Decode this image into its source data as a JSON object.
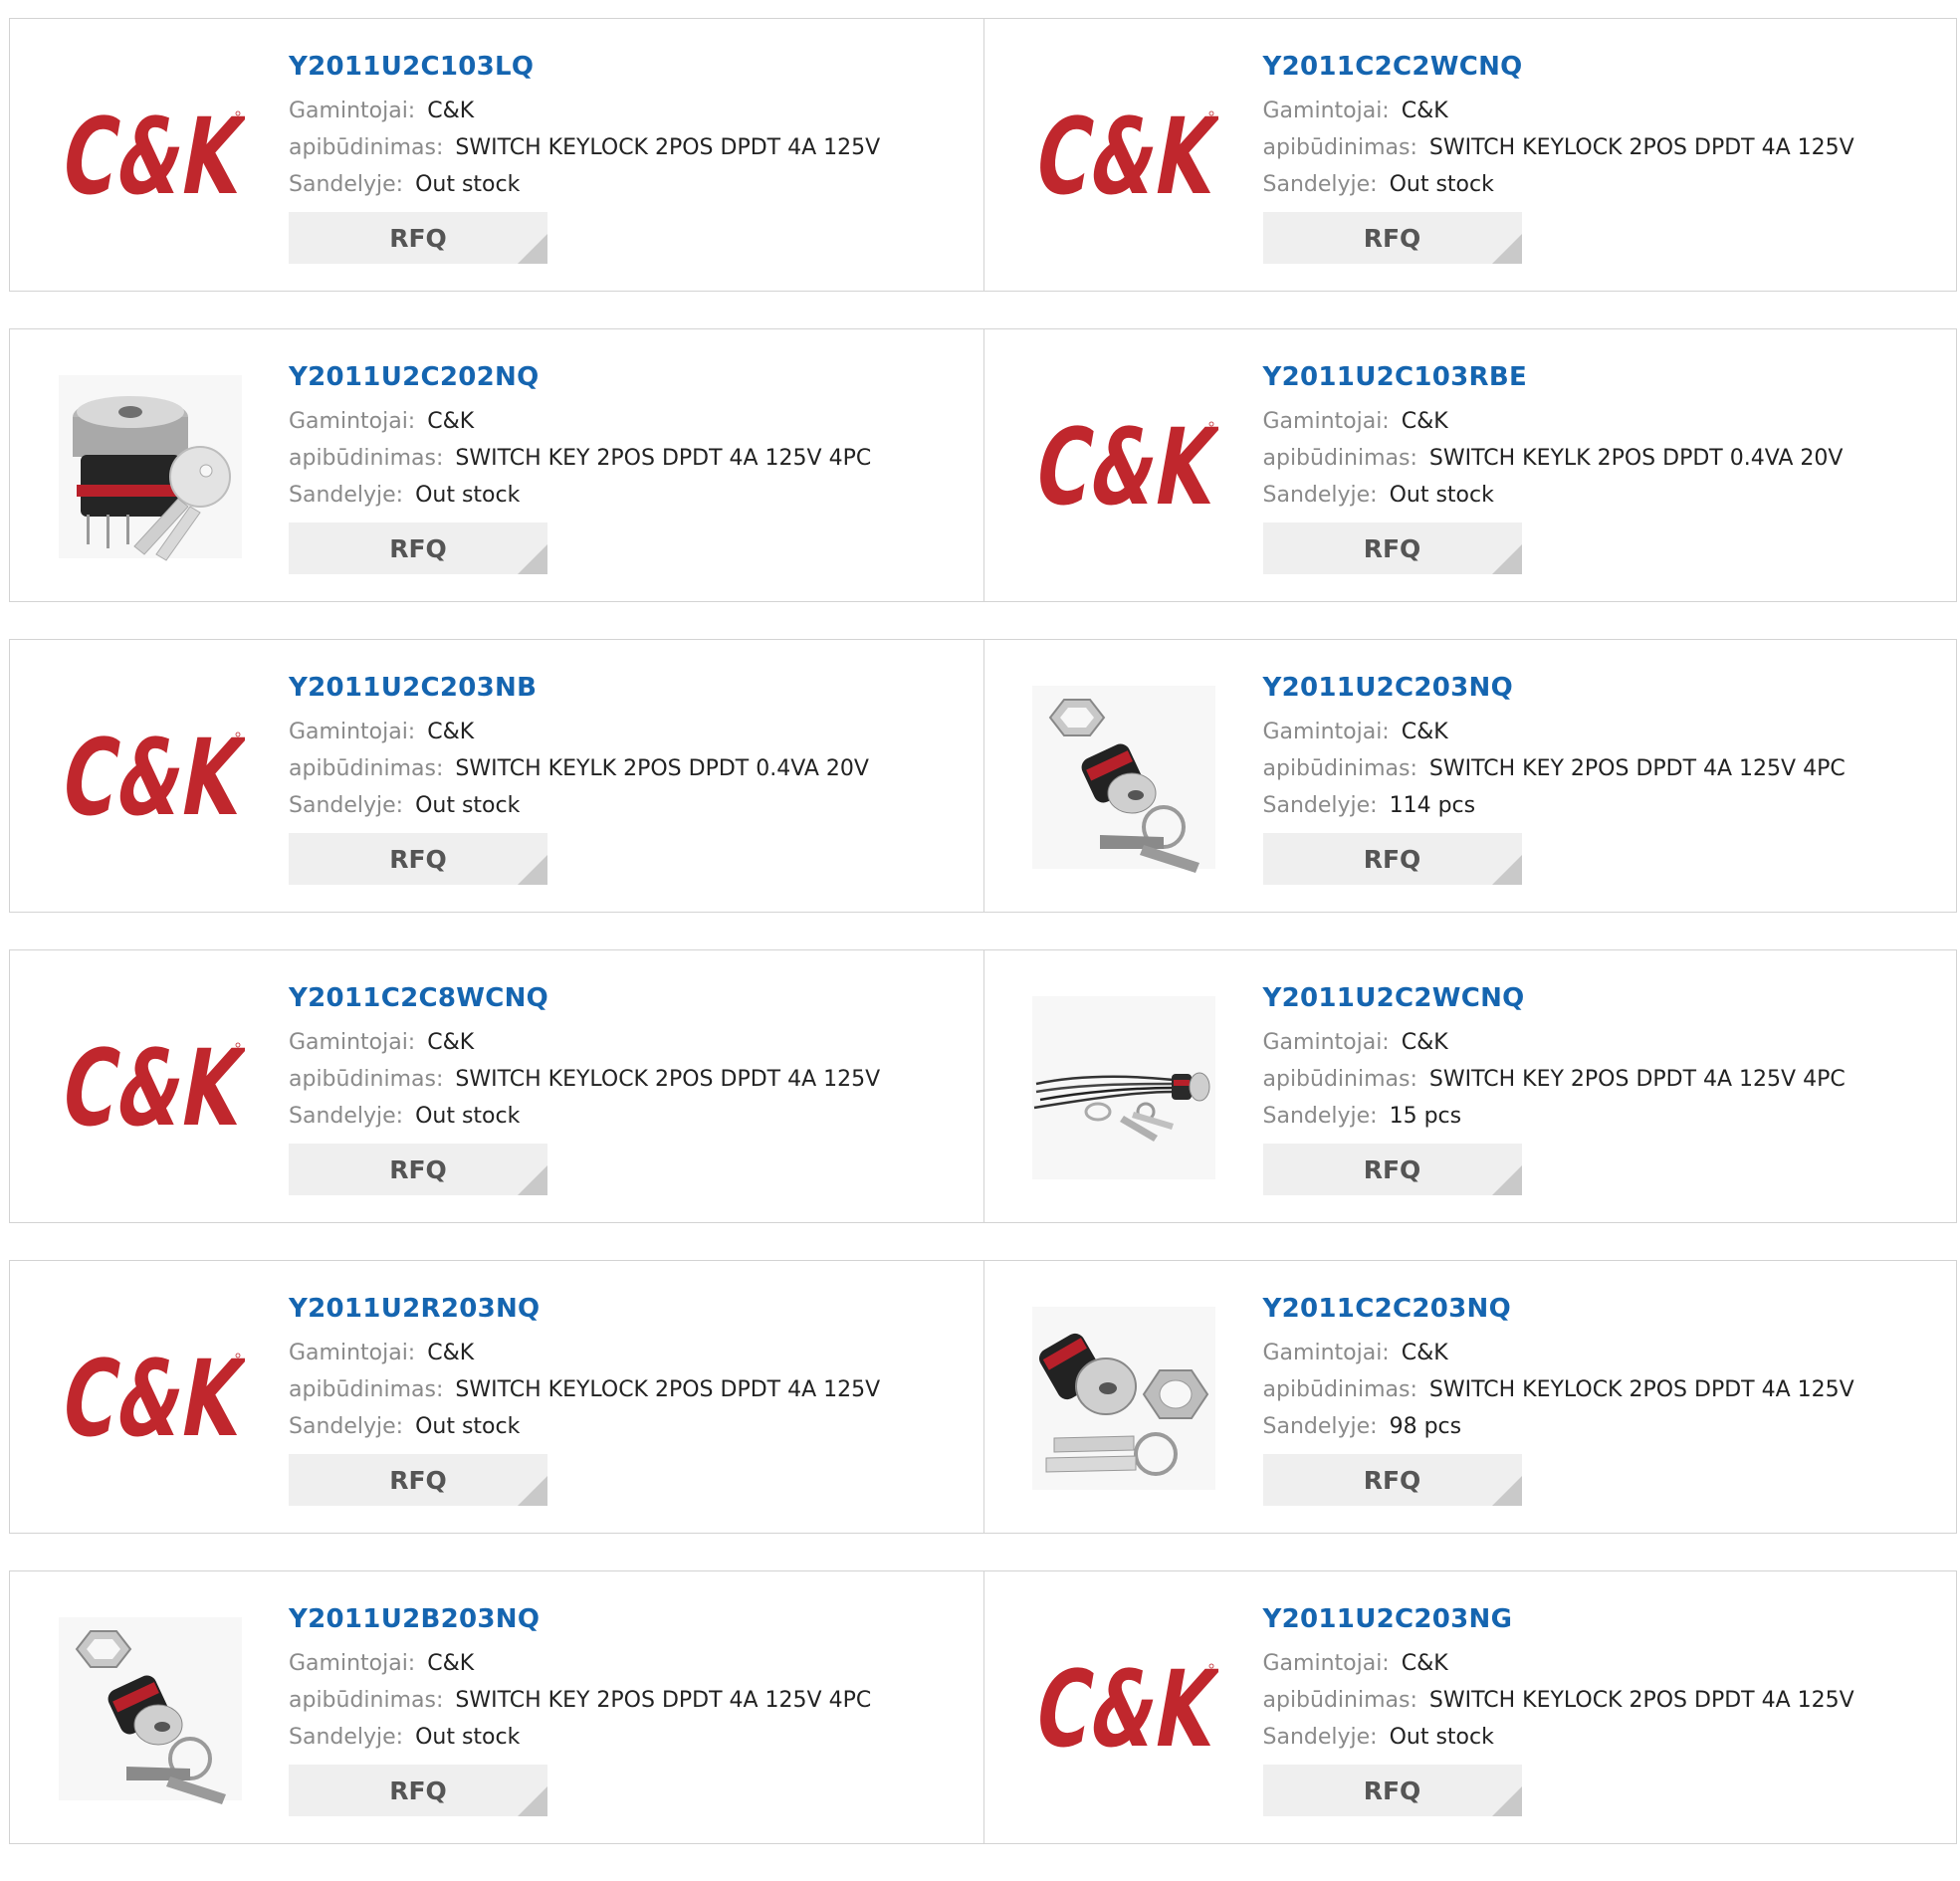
{
  "labels": {
    "manufacturer": "Gamintojai:",
    "description": "apibūdinimas:",
    "stock": "Sandelyje:",
    "rfq": "RFQ"
  },
  "colors": {
    "part_link": "#1565b0",
    "brand_red": "#c0272d",
    "rfq_bg": "#efefef"
  },
  "products": [
    {
      "part": "Y2011U2C103LQ",
      "manufacturer": "C&K",
      "description": "SWITCH KEYLOCK 2POS DPDT 4A 125V",
      "stock": "Out stock",
      "image": "ck-logo"
    },
    {
      "part": "Y2011C2C2WCNQ",
      "manufacturer": "C&K",
      "description": "SWITCH KEYLOCK 2POS DPDT 4A 125V",
      "stock": "Out stock",
      "image": "ck-logo"
    },
    {
      "part": "Y2011U2C202NQ",
      "manufacturer": "C&K",
      "description": "SWITCH KEY 2POS DPDT 4A 125V 4PC",
      "stock": "Out stock",
      "image": "keylock-switch-photo"
    },
    {
      "part": "Y2011U2C103RBE",
      "manufacturer": "C&K",
      "description": "SWITCH KEYLK 2POS DPDT 0.4VA 20V",
      "stock": "Out stock",
      "image": "ck-logo"
    },
    {
      "part": "Y2011U2C203NB",
      "manufacturer": "C&K",
      "description": "SWITCH KEYLK 2POS DPDT 0.4VA 20V",
      "stock": "Out stock",
      "image": "ck-logo"
    },
    {
      "part": "Y2011U2C203NQ",
      "manufacturer": "C&K",
      "description": "SWITCH KEY 2POS DPDT 4A 125V 4PC",
      "stock": "114 pcs",
      "image": "keylock-nut-keys-photo"
    },
    {
      "part": "Y2011C2C8WCNQ",
      "manufacturer": "C&K",
      "description": "SWITCH KEYLOCK 2POS DPDT 4A 125V",
      "stock": "Out stock",
      "image": "ck-logo"
    },
    {
      "part": "Y2011U2C2WCNQ",
      "manufacturer": "C&K",
      "description": "SWITCH KEY 2POS DPDT 4A 125V 4PC",
      "stock": "15 pcs",
      "image": "keylock-wires-photo"
    },
    {
      "part": "Y2011U2R203NQ",
      "manufacturer": "C&K",
      "description": "SWITCH KEYLOCK 2POS DPDT 4A 125V",
      "stock": "Out stock",
      "image": "ck-logo"
    },
    {
      "part": "Y2011C2C203NQ",
      "manufacturer": "C&K",
      "description": "SWITCH KEYLOCK 2POS DPDT 4A 125V",
      "stock": "98 pcs",
      "image": "keylock-keys-nut-photo"
    },
    {
      "part": "Y2011U2B203NQ",
      "manufacturer": "C&K",
      "description": "SWITCH KEY 2POS DPDT 4A 125V 4PC",
      "stock": "Out stock",
      "image": "keylock-nut-keys-photo"
    },
    {
      "part": "Y2011U2C203NG",
      "manufacturer": "C&K",
      "description": "SWITCH KEYLOCK 2POS DPDT 4A 125V",
      "stock": "Out stock",
      "image": "ck-logo"
    }
  ]
}
